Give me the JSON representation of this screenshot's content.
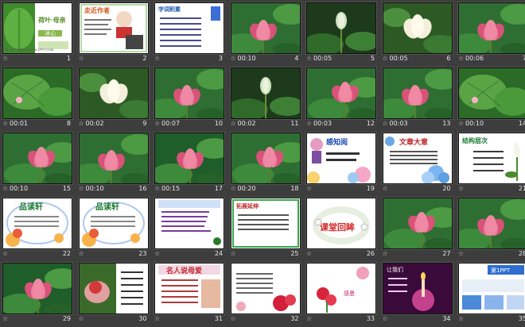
{
  "colors": {
    "background": "#3d3d3d",
    "label_text": "#e6e6e6",
    "selection": "#f0c000"
  },
  "slides": [
    {
      "number": "1",
      "time": "",
      "type": "title",
      "title": "荷叶·母亲",
      "author": "冰心",
      "footer": "第一PPT模板网-WWW.1PPT.COM"
    },
    {
      "number": "2",
      "time": "",
      "type": "author",
      "heading": "走近作者"
    },
    {
      "number": "3",
      "time": "",
      "type": "vocab",
      "heading": "字词积累"
    },
    {
      "number": "4",
      "time": "00:10",
      "type": "pink-lotus"
    },
    {
      "number": "5",
      "time": "00:05",
      "type": "bud"
    },
    {
      "number": "6",
      "time": "00:05",
      "type": "white-lotus"
    },
    {
      "number": "7",
      "time": "00:06",
      "type": "pink-lotus"
    },
    {
      "number": "8",
      "time": "00:01",
      "type": "leaf"
    },
    {
      "number": "9",
      "time": "00:02",
      "type": "white-lotus"
    },
    {
      "number": "10",
      "time": "00:07",
      "type": "pink-lotus"
    },
    {
      "number": "11",
      "time": "00:02",
      "type": "bud"
    },
    {
      "number": "12",
      "time": "00:03",
      "type": "pink-lotus"
    },
    {
      "number": "13",
      "time": "00:03",
      "type": "pink-lotus"
    },
    {
      "number": "14",
      "time": "00:10",
      "type": "leaf"
    },
    {
      "number": "15",
      "time": "00:10",
      "type": "pink-lotus"
    },
    {
      "number": "16",
      "time": "00:10",
      "type": "pink-lotus"
    },
    {
      "number": "17",
      "time": "00:15",
      "type": "pink-lotus"
    },
    {
      "number": "18",
      "time": "00:20",
      "type": "pink-lotus"
    },
    {
      "number": "19",
      "time": "",
      "type": "cartoon",
      "heading": "感知阅"
    },
    {
      "number": "20",
      "time": "",
      "type": "flower-text",
      "heading": "文章大意"
    },
    {
      "number": "21",
      "time": "",
      "type": "calla",
      "heading": "结构层次"
    },
    {
      "number": "22",
      "time": "",
      "type": "pinxi",
      "heading": "品读轩"
    },
    {
      "number": "23",
      "time": "",
      "type": "pinxi",
      "heading": "品读轩"
    },
    {
      "number": "24",
      "time": "",
      "type": "textbox",
      "heading": ""
    },
    {
      "number": "25",
      "time": "",
      "type": "frame",
      "heading": "拓展延伸"
    },
    {
      "number": "26",
      "time": "",
      "type": "wreath",
      "heading": "课堂回眸"
    },
    {
      "number": "27",
      "time": "",
      "type": "pink-lotus"
    },
    {
      "number": "28",
      "time": "",
      "type": "pink-lotus"
    },
    {
      "number": "29",
      "time": "",
      "type": "pink-lotus"
    },
    {
      "number": "30",
      "time": "",
      "type": "rose-hands"
    },
    {
      "number": "31",
      "time": "",
      "type": "quotes",
      "heading": "名人说母爱"
    },
    {
      "number": "32",
      "time": "",
      "type": "roses"
    },
    {
      "number": "33",
      "time": "",
      "type": "carnation"
    },
    {
      "number": "34",
      "time": "",
      "type": "candle",
      "heading": "让我们"
    },
    {
      "number": "35",
      "time": "",
      "type": "ad",
      "heading": "第1PPT"
    }
  ]
}
